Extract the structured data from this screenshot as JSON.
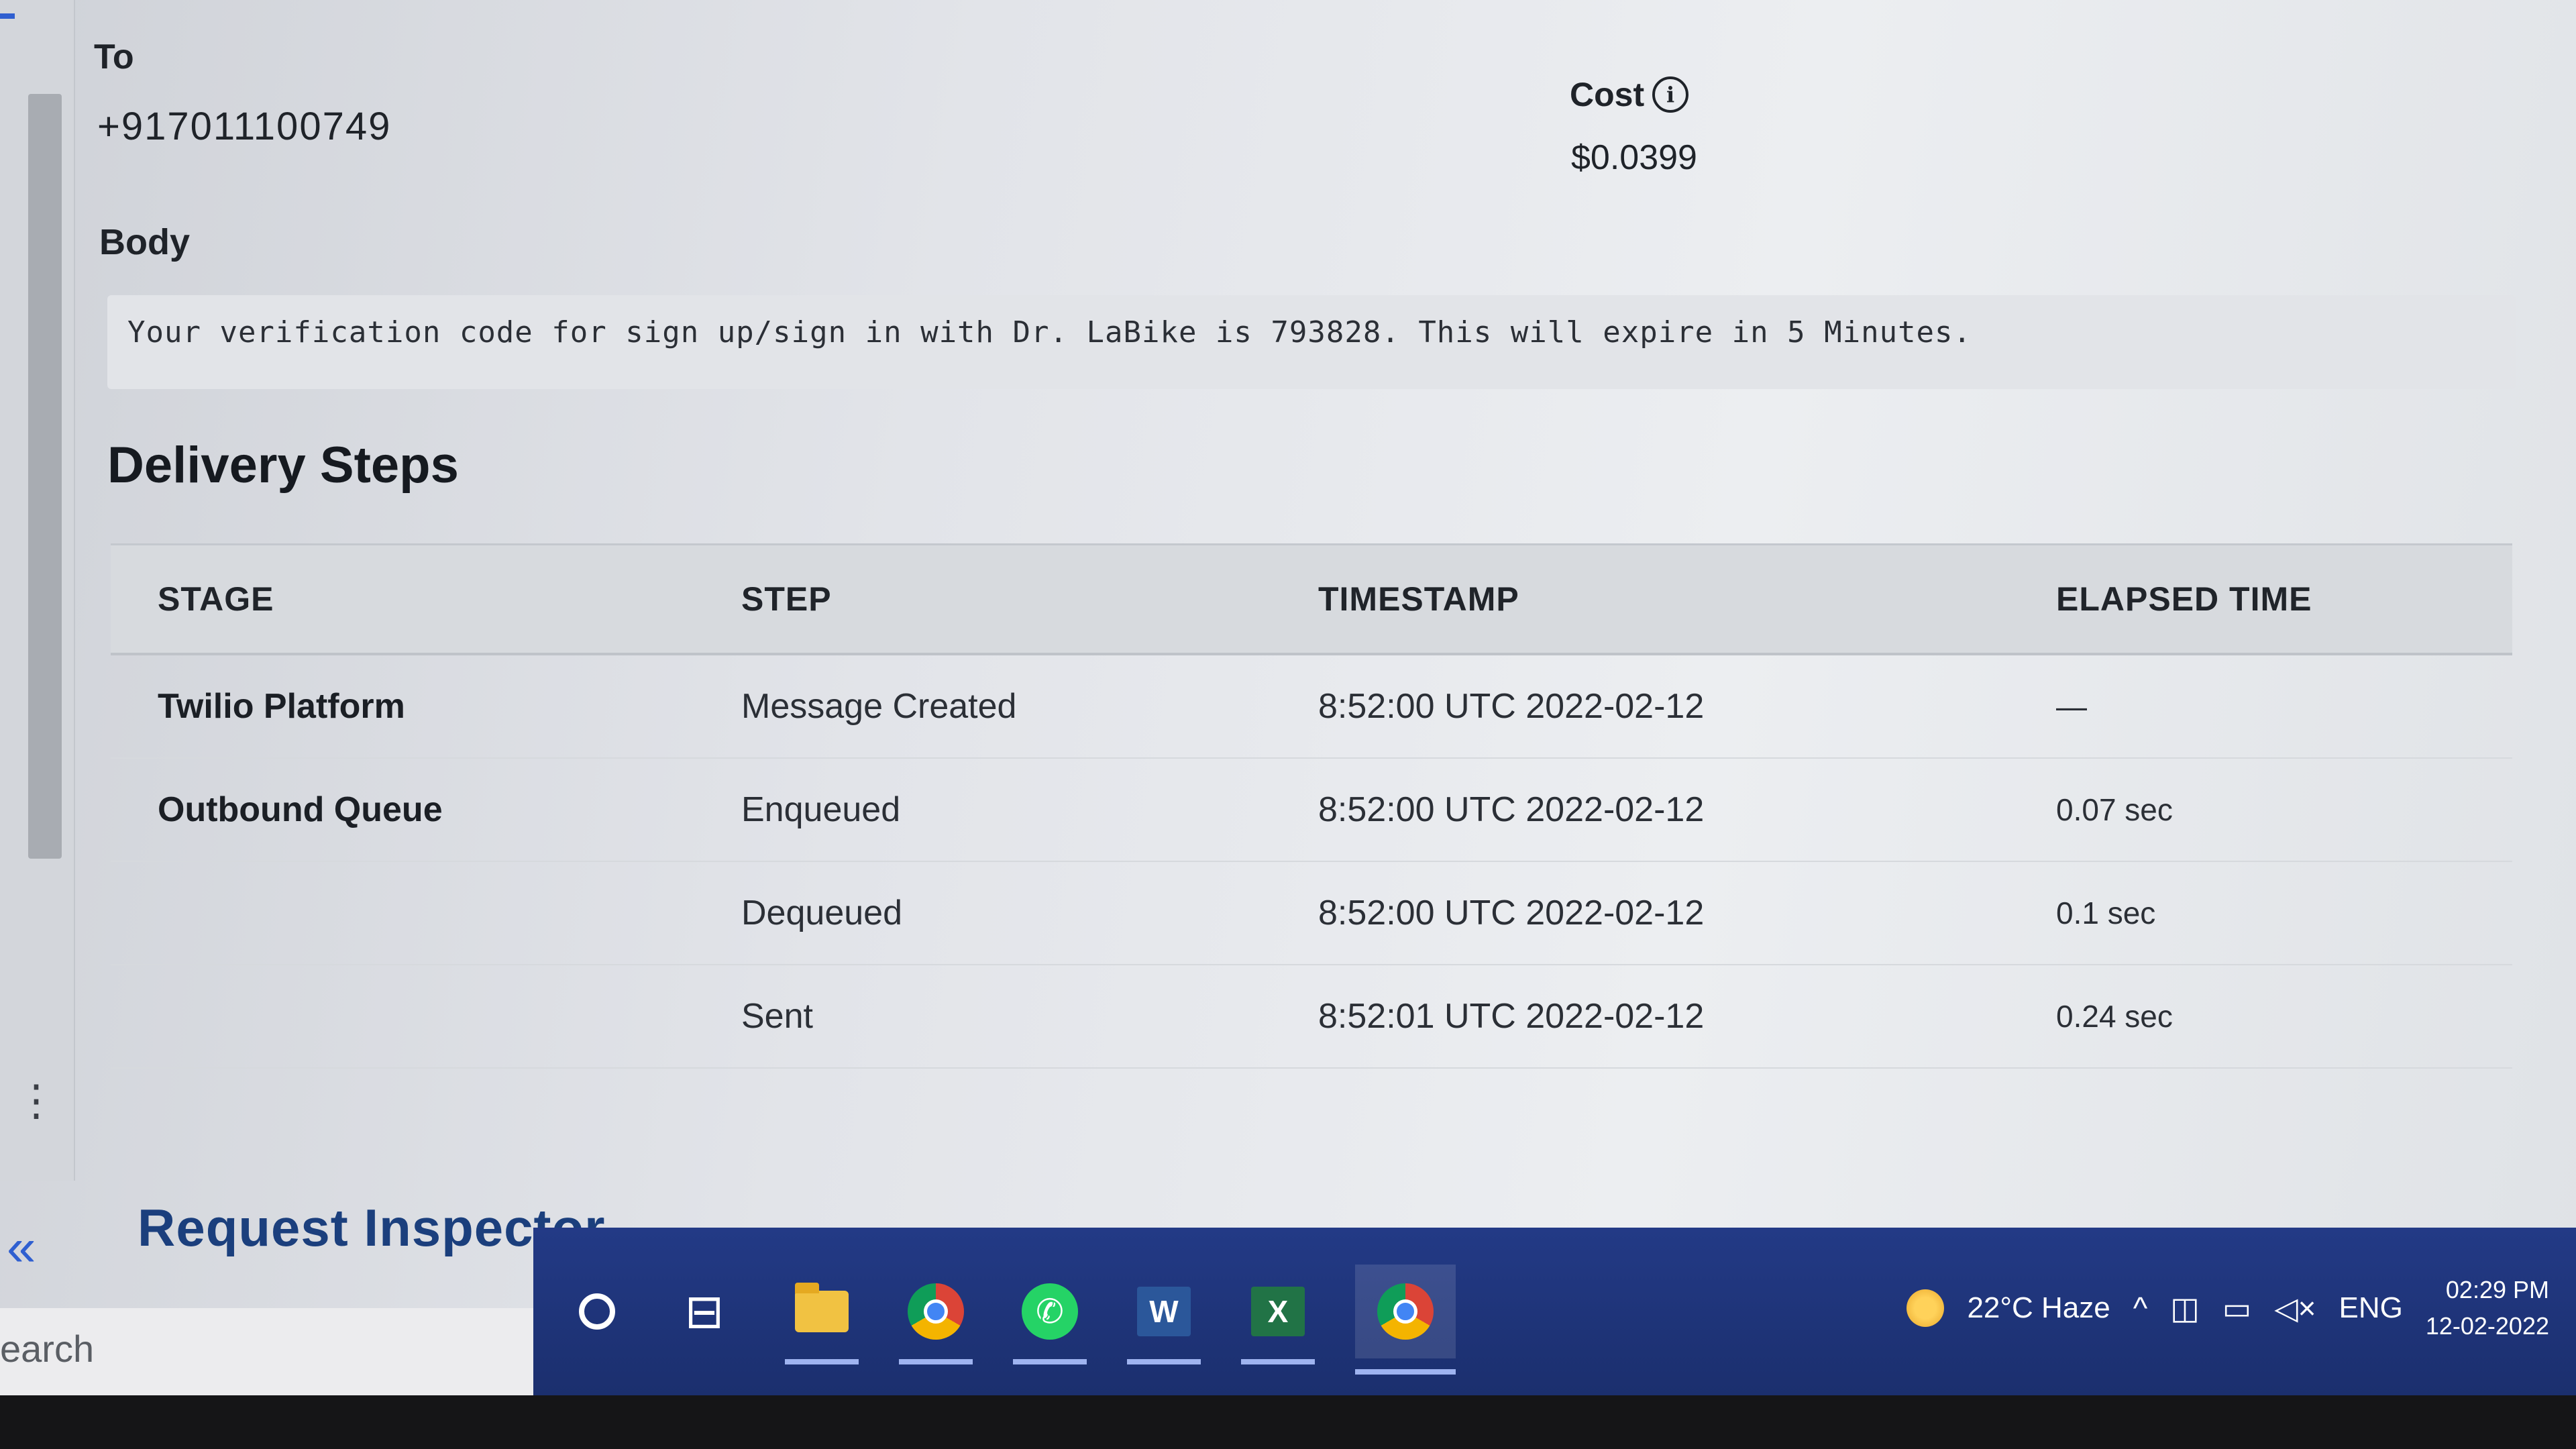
{
  "message": {
    "to_label": "To",
    "to_value": "+917011100749",
    "cost_label": "Cost",
    "cost_info_icon": "info-icon",
    "cost_value": "$0.0399",
    "body_label": "Body",
    "body_text": "Your verification code for sign up/sign in with Dr. LaBike is  793828. This will expire in 5 Minutes."
  },
  "delivery": {
    "title": "Delivery Steps",
    "columns": [
      "STAGE",
      "STEP",
      "TIMESTAMP",
      "ELAPSED TIME"
    ],
    "rows": [
      {
        "stage": "Twilio Platform",
        "step": "Message Created",
        "timestamp": "8:52:00 UTC 2022-02-12",
        "elapsed": "—"
      },
      {
        "stage": "Outbound Queue",
        "step": "Enqueued",
        "timestamp": "8:52:00 UTC 2022-02-12",
        "elapsed": "0.07 sec"
      },
      {
        "stage": "",
        "step": "Dequeued",
        "timestamp": "8:52:00 UTC 2022-02-12",
        "elapsed": "0.1 sec"
      },
      {
        "stage": "",
        "step": "Sent",
        "timestamp": "8:52:01 UTC 2022-02-12",
        "elapsed": "0.24 sec"
      }
    ]
  },
  "sidebar": {
    "collapse_glyph": "«",
    "more_glyph": "⋮"
  },
  "inspector": {
    "title": "Request Inspector"
  },
  "taskbar": {
    "search_text": "earch",
    "apps": [
      "cortana",
      "task-view",
      "file-explorer",
      "chrome",
      "whatsapp",
      "word",
      "excel",
      "chrome-profile"
    ],
    "word_glyph": "W",
    "excel_glyph": "X",
    "whatsapp_glyph": "✆",
    "taskview_glyph": "⊟",
    "weather": "22°C  Haze",
    "tray_glyphs": {
      "chevron": "^",
      "meet": "◫",
      "network": "▭",
      "volume": "◁×"
    },
    "language": "ENG",
    "time": "02:29 PM",
    "date": "12-02-2022"
  },
  "colors": {
    "accent": "#2f5fd0",
    "taskbar": "#233a86",
    "inspector_title": "#1b3f7d"
  }
}
